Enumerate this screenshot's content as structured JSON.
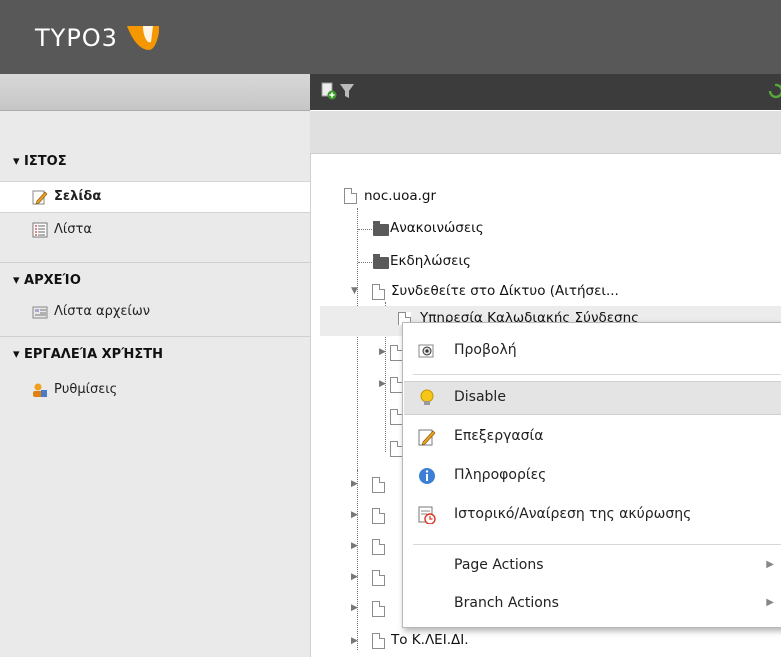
{
  "app": {
    "logo": "TYPO3"
  },
  "nav": {
    "sections": [
      {
        "title": "▾ ΙΣΤΟΣ",
        "items": [
          {
            "label": "Σελίδα",
            "icon": "edit-page-icon",
            "active": true
          },
          {
            "label": "Λίστα",
            "icon": "list-icon"
          }
        ]
      },
      {
        "title": "▾ ΑΡΧΕΊΟ",
        "items": [
          {
            "label": "Λίστα αρχείων",
            "icon": "file-list-icon"
          }
        ]
      },
      {
        "title": "▾ ΕΡΓΑΛΕΊΑ ΧΡΉΣΤΗ",
        "items": [
          {
            "label": "Ρυθμίσεις",
            "icon": "user-settings-icon"
          }
        ]
      }
    ]
  },
  "toolbar": {
    "icons": [
      "new-page-icon",
      "filter-icon",
      "refresh-icon"
    ]
  },
  "tree": {
    "root": "noc.uoa.gr",
    "items": [
      {
        "label": "Ανακοινώσεις",
        "type": "folder"
      },
      {
        "label": "Εκδηλώσεις",
        "type": "folder"
      },
      {
        "label": "Συνδεθείτε στο Δίκτυο (Αιτήσει...",
        "type": "page",
        "expanded": true
      },
      {
        "label": "Υπηρεσία Καλωδιακής Σύνδεσης",
        "type": "page"
      },
      {
        "label": "Το Κ.ΛΕΙ.ΔΙ.",
        "type": "page"
      }
    ]
  },
  "context_menu": {
    "items": [
      {
        "label": "Προβολή",
        "icon": "view-icon"
      },
      {
        "label": "Disable",
        "icon": "lightbulb-icon",
        "highlighted": true
      },
      {
        "label": "Επεξεργασία",
        "icon": "edit-icon"
      },
      {
        "label": "Πληροφορίες",
        "icon": "info-icon"
      },
      {
        "label": "Ιστορικό/Αναίρεση της ακύρωσης",
        "icon": "history-icon"
      },
      {
        "label": "Page Actions",
        "submenu": true
      },
      {
        "label": "Branch Actions",
        "submenu": true
      }
    ]
  },
  "colors": {
    "topbar": "#585858",
    "accent_orange": "#f49700",
    "selected_bg": "#e4e4e4"
  }
}
